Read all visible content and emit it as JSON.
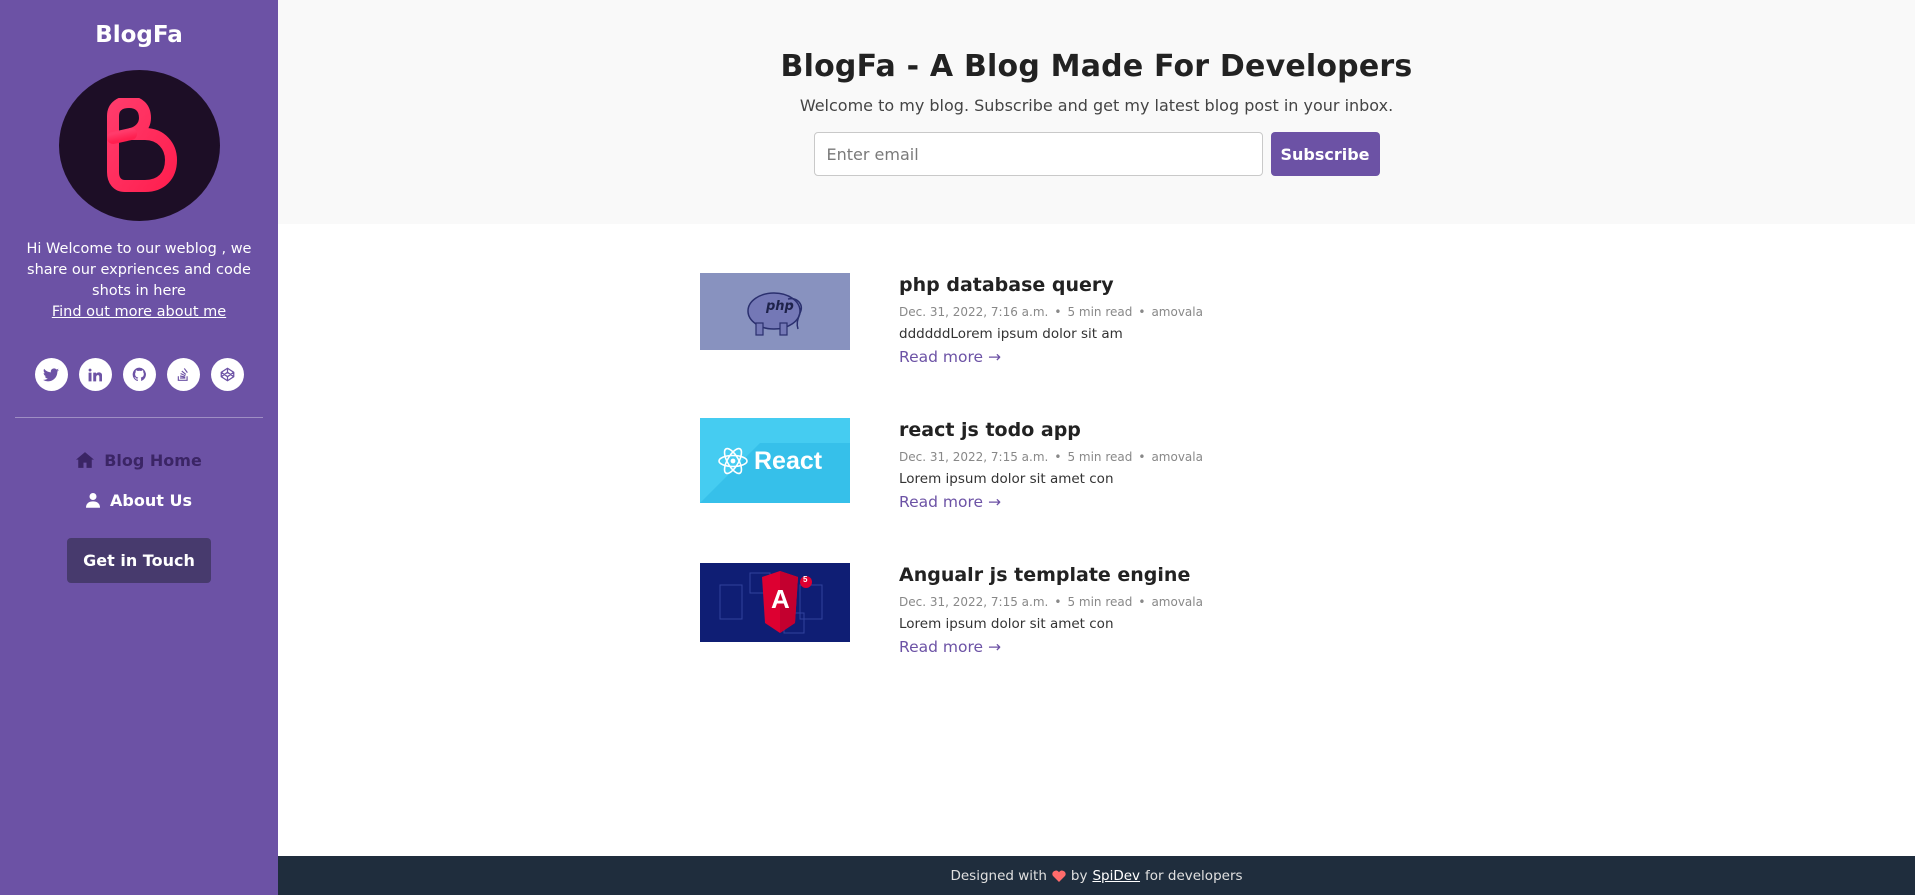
{
  "sidebar": {
    "brand": "BlogFa",
    "bio_text": "Hi Welcome to our weblog , we share our expriences and code shots in here",
    "bio_link": "Find out more about me",
    "social_icons": [
      "twitter-icon",
      "linkedin-icon",
      "github-icon",
      "stack-overflow-icon",
      "codepen-icon"
    ],
    "nav": [
      {
        "label": "Blog Home",
        "icon": "home-icon"
      },
      {
        "label": "About Us",
        "icon": "user-icon"
      }
    ],
    "cta_label": "Get in Touch",
    "bg_color": "#6c52a5"
  },
  "header": {
    "title": "BlogFa - A Blog Made For Developers",
    "tagline": "Welcome to my blog. Subscribe and get my latest blog post in your inbox.",
    "email_placeholder": "Enter email",
    "subscribe_label": "Subscribe"
  },
  "posts": [
    {
      "title": "php database query",
      "date": "Dec. 31, 2022, 7:16 a.m.",
      "read_time": "5 min read",
      "author": "amovala",
      "excerpt": "ddddddLorem ipsum dolor sit am",
      "read_more": "Read more →",
      "thumb_text": "php"
    },
    {
      "title": "react js todo app",
      "date": "Dec. 31, 2022, 7:15 a.m.",
      "read_time": "5 min read",
      "author": "amovala",
      "excerpt": "Lorem ipsum dolor sit amet con",
      "read_more": "Read more →",
      "thumb_text": "React"
    },
    {
      "title": "Angualr js template engine",
      "date": "Dec. 31, 2022, 7:15 a.m.",
      "read_time": "5 min read",
      "author": "amovala",
      "excerpt": "Lorem ipsum dolor sit amet con",
      "read_more": "Read more →",
      "thumb_text": "A",
      "thumb_badge": "5"
    }
  ],
  "footer": {
    "prefix": "Designed with",
    "by": "by",
    "link": "SpiDev",
    "suffix": "for developers"
  },
  "colors": {
    "accent": "#6c52a5",
    "footer_bg": "#1f2d3d",
    "heart": "#ff6b6b"
  }
}
